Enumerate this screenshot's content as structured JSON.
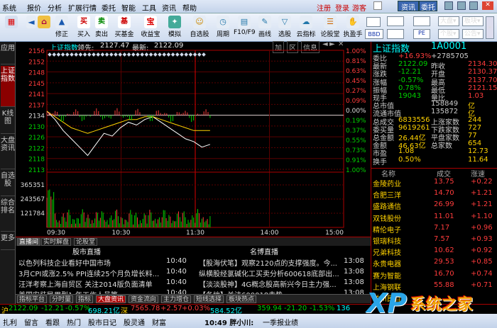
{
  "menu": {
    "items": [
      "系统",
      "报价",
      "分析",
      "扩展行情",
      "委托",
      "智能",
      "工具",
      "资讯",
      "帮助"
    ],
    "right": [
      "注册",
      "登录",
      "游客"
    ],
    "tabs": [
      "资讯",
      "委托"
    ]
  },
  "toolbar": {
    "buttons": [
      "买入",
      "卖出",
      "买基金",
      "收益宝",
      "模拟",
      "自选股",
      "周期",
      "F10/F9",
      "画线",
      "选股",
      "云指标",
      "论股堂",
      "执盈手"
    ],
    "left_buttons": [
      "修正"
    ],
    "right_buttons": [
      "BBD",
      "大盘",
      "板块",
      "个股",
      "公告"
    ]
  },
  "sidetabs": [
    "应用",
    "上证指数",
    "K线图",
    "大盘资讯",
    "自选股",
    "综合排名",
    "更多"
  ],
  "chart": {
    "title": "上证指数",
    "lead_label": "领先:",
    "lead_value": "2127.47",
    "latest_label": "最新:",
    "latest_value": "2122.09",
    "header_buttons": [
      "加",
      "区",
      "信息"
    ],
    "y_labels": [
      "2156",
      "2152",
      "2148",
      "2145",
      "2141",
      "2137",
      "2134",
      "2130",
      "2126",
      "2122",
      "2118",
      "2113"
    ],
    "pct_labels": [
      "1.00%",
      "0.81%",
      "0.63%",
      "0.45%",
      "0.27%",
      "0.09%",
      "0.00%",
      "0.19%",
      "0.37%",
      "0.55%",
      "0.73%",
      "0.91%",
      "1.00%"
    ],
    "vol_labels": [
      "365351",
      "243567",
      "121784"
    ],
    "x_labels": [
      "09:30",
      "10:30",
      "11:30",
      "14:00",
      "15:00"
    ]
  },
  "chart_data": {
    "type": "line",
    "x_range": [
      "09:30",
      "15:00"
    ],
    "ylim": [
      2113,
      2156
    ],
    "prev_close": 2134.3,
    "series": [
      {
        "name": "最新",
        "values": [
          2134,
          2131,
          2127,
          2124,
          2121,
          2118,
          2122,
          2126,
          2125,
          2128,
          2130,
          2129,
          2131,
          2132,
          2130,
          2128,
          2126,
          2124,
          2123,
          2121,
          2122
        ]
      },
      {
        "name": "领先",
        "values": [
          2134,
          2132,
          2130,
          2128,
          2127,
          2126,
          2127,
          2128,
          2129,
          2130,
          2131,
          2131,
          2132,
          2132,
          2131,
          2130,
          2129,
          2128,
          2127,
          2127,
          2127
        ]
      }
    ]
  },
  "quote": {
    "name": "上证指数",
    "code": "1A0001",
    "rows": [
      [
        "委比",
        "+16.93%",
        "+2785705"
      ],
      [
        "最新",
        "2122.09",
        "昨收",
        "2134.30"
      ],
      [
        "涨跌",
        "-12.21",
        "开盘",
        "2130.37"
      ],
      [
        "涨幅",
        "-0.57%",
        "最高",
        "2137.70"
      ],
      [
        "振幅",
        "0.78%",
        "最低",
        "2121.15"
      ],
      [
        "现手",
        "19043",
        "量比",
        "1.03"
      ],
      [
        "总市值",
        "",
        "158849",
        "亿"
      ],
      [
        "流通市值",
        "",
        "135872",
        "亿"
      ],
      [
        "总成交",
        "6833556",
        "上涨家数",
        "244"
      ],
      [
        "委买量",
        "9619261",
        "下跌家数",
        "727"
      ],
      [
        "总金额",
        "26.44亿",
        "平盘家数",
        "77"
      ],
      [
        "金额",
        "46.63亿",
        "总家数",
        "654"
      ],
      [
        "市盈",
        "1.08",
        "",
        "12.73"
      ],
      [
        "换手",
        "0.50%",
        "",
        "11.64"
      ]
    ]
  },
  "stock_list": {
    "headers": [
      "名称",
      "成交",
      "涨速"
    ],
    "rows": [
      [
        "金陵药业",
        "13.75",
        "+0.22"
      ],
      [
        "合肥三洋",
        "14.70",
        "+1.21"
      ],
      [
        "盛路通信",
        "26.99",
        "+1.21"
      ],
      [
        "双钱股份",
        "11.01",
        "+1.10"
      ],
      [
        "精伦电子",
        "7.17",
        "+0.96"
      ],
      [
        "银瑞科技",
        "7.57",
        "+0.93"
      ],
      [
        "兄弟科技",
        "10.62",
        "+0.92"
      ],
      [
        "永贵电器",
        "29.53",
        "+0.85"
      ],
      [
        "赛为智能",
        "16.70",
        "+0.74"
      ],
      [
        "上海钢联",
        "55.88",
        "+0.71"
      ],
      [
        "兰州民百",
        "",
        ""
      ]
    ]
  },
  "news": {
    "tabs": [
      "直播间",
      "实时解盘",
      "论股堂"
    ],
    "left_header": "股市直播",
    "right_header": "名博直播",
    "left": [
      [
        "以色列科技企业看好中国市场",
        "10:40"
      ],
      [
        "3月CPI或涨2.5% PPI连续25个月负增长料...",
        "10:40"
      ],
      [
        "汪洋考察上海自贸区 关注2014版负面清单",
        "10:40"
      ],
      [
        "美国安装民用型1-年工作人员等...",
        "10:40"
      ]
    ],
    "right": [
      [
        "【股海伏笔】观察2120点的支撑强度。今...",
        "13:08"
      ],
      [
        "纵横股经氯碱化工买卖分析600618底部出...",
        "13:08"
      ],
      [
        "【淡淡股神】4G概念股高新兴今日主力强...",
        "13:08"
      ],
      [
        "【各地】关注600018走势...",
        "13:08"
      ]
    ]
  },
  "bottabs": [
    "指标平台",
    "分时量",
    "指标",
    "大盘资讯",
    "资金流向",
    "主力增仓",
    "短线选择",
    "板块热点"
  ],
  "status": {
    "sh_label": "沪",
    "sh": "2122.09",
    "sh_chg": "-12.21",
    "sh_pct": "-0.57%",
    "sh_amt": "698.21亿",
    "sz_label": "深",
    "sz": "7565.78",
    "sz_chg": "+2.57",
    "sz_pct": "+0.03%",
    "sz_amt": "584.52亿",
    "x3": "359.94",
    "x3_chg": "-21.20",
    "x3_pct": "-1.53%",
    "x3_amt": "136"
  },
  "footer": {
    "items": [
      "扎利",
      "留言",
      "看跟",
      "热门",
      "股市日记",
      "股灵通",
      "财富"
    ],
    "time": "10:49 胖小川:",
    "msg": "一季报业绩"
  },
  "watermark": {
    "text1": "XP",
    "text2": "系统之家"
  }
}
